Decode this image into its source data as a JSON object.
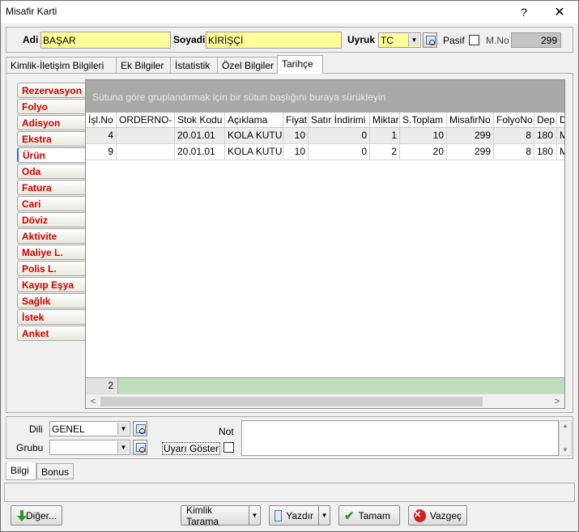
{
  "window": {
    "title": "Misafir Karti",
    "help_glyph": "?",
    "close_glyph": "✕"
  },
  "header": {
    "adi_label": "Adi",
    "adi_value": "BAŞAR",
    "soyadi_label": "Soyadi",
    "soyadi_value": "KİRİŞÇİ",
    "uyruk_label": "Uyruk",
    "uyruk_value": "TC",
    "pasif_label": "Pasif",
    "mno_label": "M.No",
    "mno_value": "299"
  },
  "tabs": [
    {
      "label": "Kimlik-İletişim Bilgileri"
    },
    {
      "label": "Ek Bilgiler"
    },
    {
      "label": "İstatistik"
    },
    {
      "label": "Özel Bilgiler"
    },
    {
      "label": "Tarihçe",
      "active": true
    }
  ],
  "side_tabs": [
    {
      "label": "Rezervasyon"
    },
    {
      "label": "Folyo"
    },
    {
      "label": "Adisyon"
    },
    {
      "label": "Ekstra"
    },
    {
      "label": "Ürün",
      "active": true
    },
    {
      "label": "Oda"
    },
    {
      "label": "Fatura"
    },
    {
      "label": "Cari"
    },
    {
      "label": "Döviz"
    },
    {
      "label": "Aktivite"
    },
    {
      "label": "Maliye L."
    },
    {
      "label": "Polis L."
    },
    {
      "label": "Kayıp Eşya"
    },
    {
      "label": "Sağlık"
    },
    {
      "label": "İstek"
    },
    {
      "label": "Anket"
    }
  ],
  "grid": {
    "group_panel_text": "Sütuna göre gruplandırmak için bir sütun başlığını buraya sürükleyin",
    "columns": [
      "İşl.No",
      "ORDERNO-",
      "Stok Kodu",
      "Açıklama",
      "Fiyat",
      "Satır İndirimi",
      "Miktar",
      "S.Toplam",
      "MisafirNo",
      "FolyoNo",
      "Dep",
      "D"
    ],
    "rows": [
      [
        "4",
        "",
        "20.01.01",
        "KOLA KUTU",
        "10",
        "0",
        "1",
        "10",
        "299",
        "8",
        "180",
        "M"
      ],
      [
        "9",
        "",
        "20.01.01",
        "KOLA KUTU",
        "10",
        "0",
        "2",
        "20",
        "299",
        "8",
        "180",
        "M"
      ]
    ],
    "footer_count": "2"
  },
  "bottom": {
    "dili_label": "Dili",
    "dili_value": "GENEL",
    "grubu_label": "Grubu",
    "grubu_value": "",
    "not_label": "Not",
    "uyari_label": "Uyarı Göster"
  },
  "bottom_tabs": [
    {
      "label": "Bilgi",
      "active": true
    },
    {
      "label": "Bonus"
    }
  ],
  "buttons": {
    "diger": "Diğer...",
    "kimlik_tarama": "Kimlik Tarama",
    "yazdir": "Yazdır",
    "tamam": "Tamam",
    "vazgec": "Vazgeç"
  }
}
